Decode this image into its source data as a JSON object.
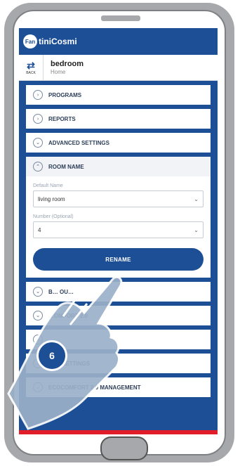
{
  "app": {
    "logo_mark": "Fan",
    "logo_text": "tiniCosmi"
  },
  "header": {
    "back_label": "BACK",
    "title": "bedroom",
    "subtitle": "Home"
  },
  "menu_top": [
    {
      "label": "PROGRAMS"
    },
    {
      "label": "REPORTS"
    },
    {
      "label": "ADVANCED SETTINGS"
    }
  ],
  "room_name_panel": {
    "title": "ROOM NAME",
    "default_name_label": "Default Name",
    "default_name_value": "living room",
    "number_label": "Number (Optional)",
    "number_value": "4",
    "rename_label": "RENAME"
  },
  "menu_bottom": [
    {
      "label": "B… OU…"
    },
    {
      "label": "…OMFORT 2.0"
    },
    {
      "label": ""
    },
    {
      "label": "WIFI SETTINGS"
    },
    {
      "label": "ECOCOMFORT 2.0 MANAGEMENT"
    }
  ],
  "step_number": "6",
  "colors": {
    "primary": "#1c4f95",
    "alert": "#e21d2a",
    "phone_frame": "#a6a8ab"
  }
}
